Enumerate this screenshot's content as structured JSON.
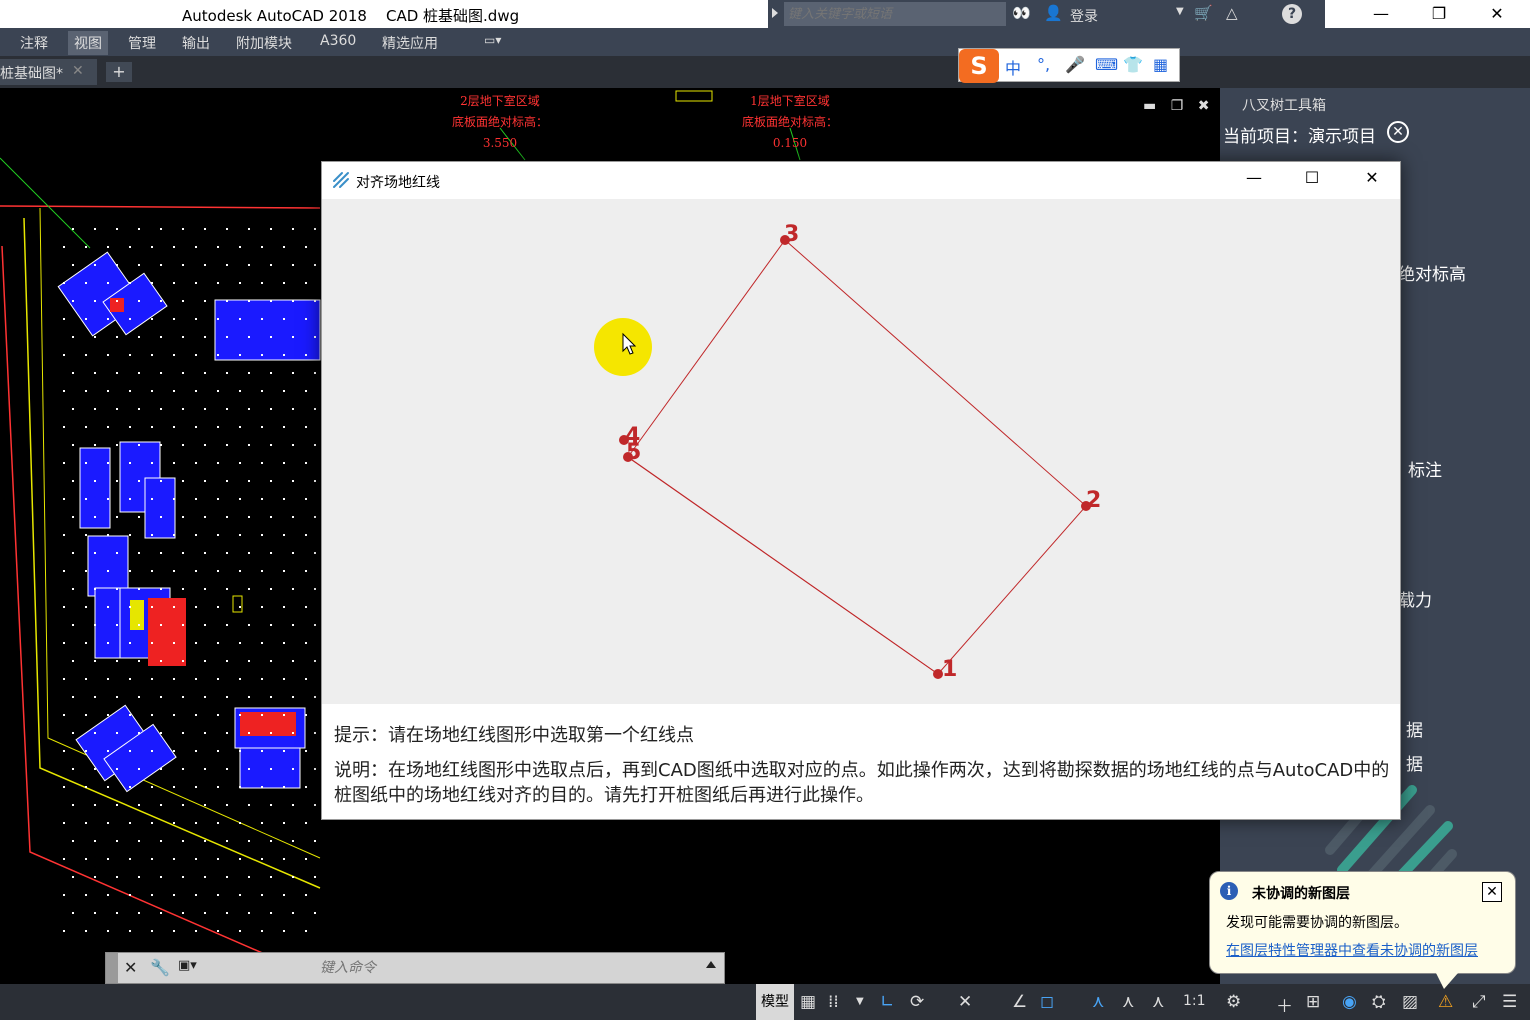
{
  "titlebar": {
    "title": "Autodesk AutoCAD 2018    CAD 桩基础图.dwg",
    "search_placeholder": "键入关键字或短语",
    "login": "登录",
    "minimize": "—",
    "restore": "❐",
    "close": "✕"
  },
  "ribbon": {
    "tabs": [
      {
        "label": "注释"
      },
      {
        "label": "视图"
      },
      {
        "label": "管理"
      },
      {
        "label": "输出"
      },
      {
        "label": "附加模块"
      },
      {
        "label": "A360"
      },
      {
        "label": "精选应用"
      }
    ],
    "active_tab": "视图"
  },
  "tabs": {
    "doc_tab": "桩基础图*",
    "new_tab": "+"
  },
  "ime": {
    "logo": "S",
    "mode": "中"
  },
  "cad": {
    "label_left": [
      "2层地下室区域",
      "底板面绝对标高：3.550"
    ],
    "label_right": [
      "1层地下室区域",
      "底板面绝对标高：0.150"
    ],
    "colors": {
      "red": "#ff3333",
      "yellow": "#e6e600",
      "blue": "#1a1aff",
      "green": "#22cc22",
      "white": "#ffffff"
    }
  },
  "dialog": {
    "title": "对齐场地红线",
    "hint": "提示：请在场地红线图形中选取第一个红线点",
    "description": "说明：在场地红线图形中选取点后，再到CAD图纸中选取对应的点。如此操作两次，达到将勘探数据的场地红线的点与AutoCAD中的桩图纸中的场地红线对齐的目的。请先打开桩图纸后再进行此操作。",
    "redline_color": "#c0282a",
    "cursor_highlight": "#f5e600"
  },
  "palette": {
    "title": "八叉树工具箱",
    "project": "当前项目：演示项目",
    "fragments": [
      "绝对标高",
      "标注",
      "载力",
      "据",
      "据"
    ]
  },
  "command": {
    "placeholder": "键入命令"
  },
  "status": {
    "model": "模型",
    "scale": "1:1"
  },
  "notification": {
    "title": "未协调的新图层",
    "body": "发现可能需要协调的新图层。",
    "link": "在图层特性管理器中查看未协调的新图层"
  }
}
